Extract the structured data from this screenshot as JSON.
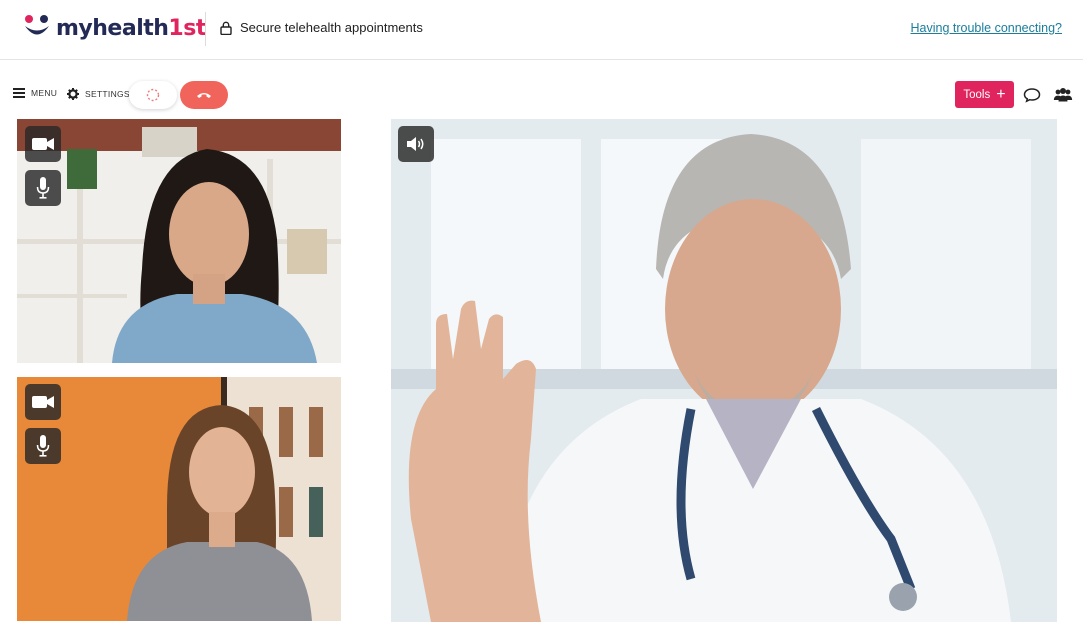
{
  "header": {
    "logo_text_primary": "myhealth",
    "logo_text_accent": "1st",
    "secure_label": "Secure telehealth appointments",
    "trouble_link": "Having trouble connecting?"
  },
  "toolbar": {
    "menu_label": "MENU",
    "settings_label": "SETTINGS",
    "tools_label": "Tools"
  },
  "colors": {
    "brand_pink": "#e0245e",
    "hangup_red": "#f0645b",
    "link_teal": "#1a7e9c",
    "navy": "#222a55"
  },
  "tiles": [
    {
      "participant": "patient-1",
      "controls": [
        "video-camera-icon",
        "microphone-icon"
      ]
    },
    {
      "participant": "patient-2",
      "controls": [
        "video-camera-icon",
        "microphone-icon"
      ]
    },
    {
      "participant": "doctor",
      "controls": [
        "speaker-icon"
      ]
    }
  ]
}
